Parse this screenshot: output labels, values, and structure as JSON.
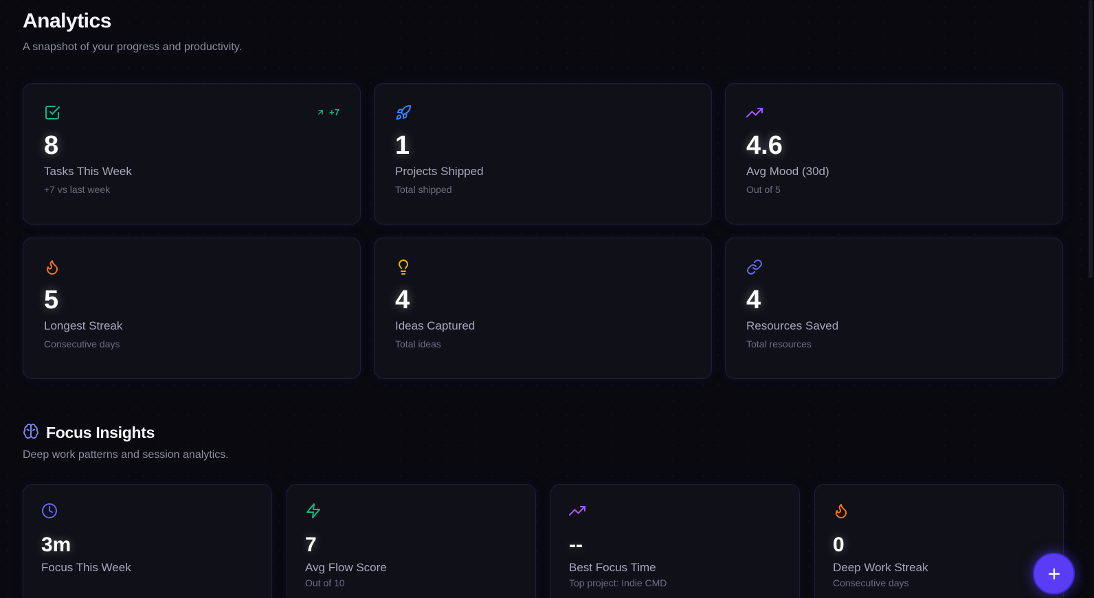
{
  "header": {
    "title": "Analytics",
    "subtitle": "A snapshot of your progress and productivity."
  },
  "stats": [
    {
      "icon": "check-square-icon",
      "color": "#10b981",
      "value": "8",
      "label": "Tasks This Week",
      "sub": "+7 vs last week",
      "trend": "+7"
    },
    {
      "icon": "rocket-icon",
      "color": "#3b82f6",
      "value": "1",
      "label": "Projects Shipped",
      "sub": "Total shipped"
    },
    {
      "icon": "trending-up-icon",
      "color": "#a855f7",
      "value": "4.6",
      "label": "Avg Mood (30d)",
      "sub": "Out of 5"
    },
    {
      "icon": "flame-icon",
      "color": "#f97316",
      "value": "5",
      "label": "Longest Streak",
      "sub": "Consecutive days"
    },
    {
      "icon": "lightbulb-icon",
      "color": "#eab308",
      "value": "4",
      "label": "Ideas Captured",
      "sub": "Total ideas"
    },
    {
      "icon": "link-icon",
      "color": "#6366f1",
      "value": "4",
      "label": "Resources Saved",
      "sub": "Total resources"
    }
  ],
  "focus": {
    "title": "Focus Insights",
    "subtitle": "Deep work patterns and session analytics.",
    "icon": "brain-icon",
    "cards": [
      {
        "icon": "clock-icon",
        "color": "#6366f1",
        "value": "3m",
        "label": "Focus This Week",
        "sub": ""
      },
      {
        "icon": "zap-icon",
        "color": "#10b981",
        "value": "7",
        "label": "Avg Flow Score",
        "sub": "Out of 10"
      },
      {
        "icon": "trending-up-icon",
        "color": "#a855f7",
        "value": "--",
        "label": "Best Focus Time",
        "sub": "Top project: Indie CMD"
      },
      {
        "icon": "flame-icon",
        "color": "#f97316",
        "value": "0",
        "label": "Deep Work Streak",
        "sub": "Consecutive days"
      }
    ]
  },
  "fab": {
    "icon": "plus-icon",
    "color": "#5a3cf5"
  }
}
